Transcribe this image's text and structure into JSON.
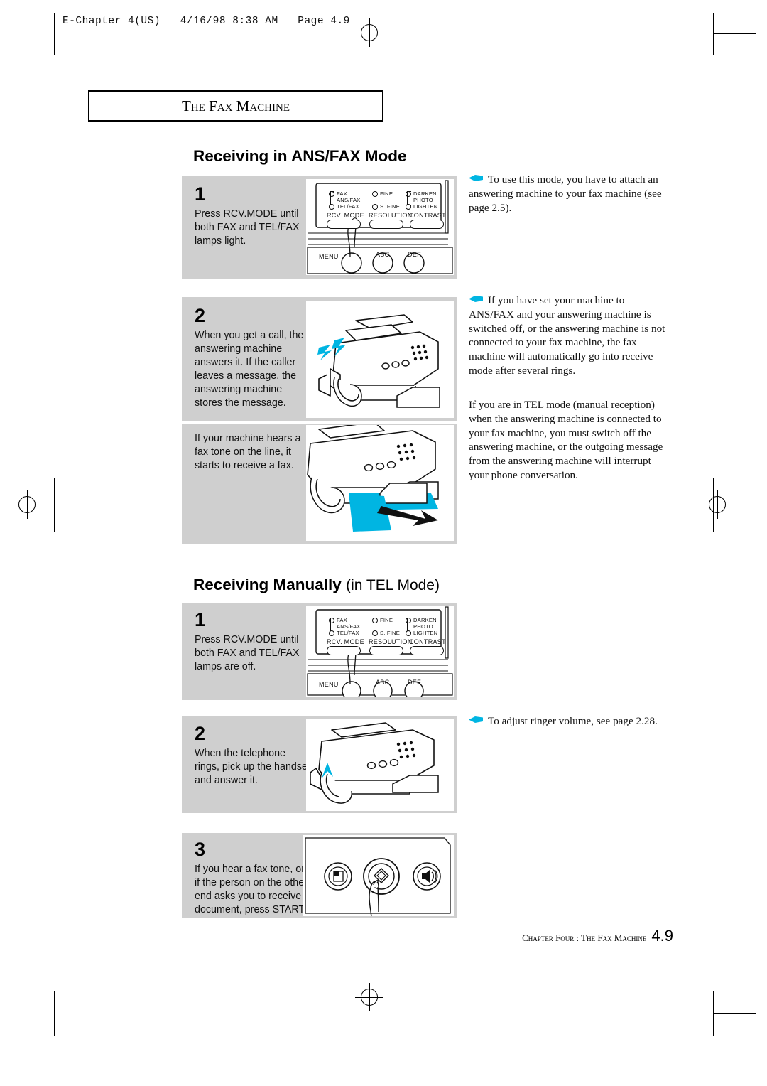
{
  "page": {
    "slug": "E-Chapter 4(US)   4/16/98 8:38 AM   Page 4.9",
    "chapter_title": "The Fax Machine",
    "footer_text": "Chapter Four : The Fax Machine",
    "footer_page": "4.9",
    "accent_color": "#00b5e2",
    "panel_color": "#cfcfcf"
  },
  "sections": [
    {
      "heading": "Receiving in ANS/FAX Mode",
      "heading_suffix": "",
      "steps": [
        {
          "number": "1",
          "text": "Press RCV.MODE until both FAX and TEL/FAX lamps light.",
          "art": "control-panel"
        },
        {
          "number": "2",
          "text": "When you get a call, the answering machine answers it. If the caller leaves a message, the answering machine stores the message.",
          "art": "fax-machine-ringing"
        },
        {
          "number": "",
          "text": "If your machine hears a fax tone on the line, it starts to receive a fax.",
          "art": "fax-machine-printing"
        }
      ],
      "notes": [
        {
          "bulleted": true,
          "text": "To use this mode, you have to attach an answering machine to your fax machine (see page 2.5)."
        },
        {
          "bulleted": true,
          "text": "If you have set your machine to ANS/FAX and your answering machine is switched off, or the answering machine is not connected to your fax machine, the fax machine will automatically go into receive mode after several rings."
        },
        {
          "bulleted": false,
          "text": "If you are in TEL mode (manual reception) when the answering machine is connected to your fax machine, you must switch off the answering machine, or the outgoing message from the answering machine will interrupt your phone conversation."
        }
      ]
    },
    {
      "heading": "Receiving Manually",
      "heading_suffix": "(in TEL Mode)",
      "steps": [
        {
          "number": "1",
          "text": "Press RCV.MODE until both FAX and TEL/FAX lamps are off.",
          "art": "control-panel"
        },
        {
          "number": "2",
          "text": "When the telephone rings, pick up the handset and answer it.",
          "art": "fax-machine-handset"
        },
        {
          "number": "3",
          "text": "If you hear a fax tone, or if the person on the other end asks you to receive a document, press START.",
          "art": "start-buttons"
        }
      ],
      "notes": [
        {
          "bulleted": true,
          "text": "To adjust ringer volume, see page 2.28."
        }
      ]
    }
  ],
  "control_panel": {
    "lamps": [
      {
        "label": "FAX"
      },
      {
        "label": "ANS/FAX"
      },
      {
        "label": "TEL/FAX"
      },
      {
        "label": "FINE"
      },
      {
        "label": "S. FINE"
      },
      {
        "label": "DARKEN"
      },
      {
        "label": "PHOTO"
      },
      {
        "label": "LIGHTEN"
      }
    ],
    "buttons": [
      {
        "label": "RCV. MODE"
      },
      {
        "label": "RESOLUTION"
      },
      {
        "label": "CONTRAST"
      }
    ],
    "keypad": [
      {
        "label": "MENU"
      },
      {
        "label": "ABC"
      },
      {
        "label": "DEF"
      }
    ]
  },
  "start_panel": {
    "buttons": [
      {
        "label": "COPY",
        "icon": "copy-icon"
      },
      {
        "label": "START/ENTER",
        "icon": "diamond-icon"
      },
      {
        "label": "OHD/V.REQ.",
        "icon": "speaker-icon"
      }
    ]
  }
}
